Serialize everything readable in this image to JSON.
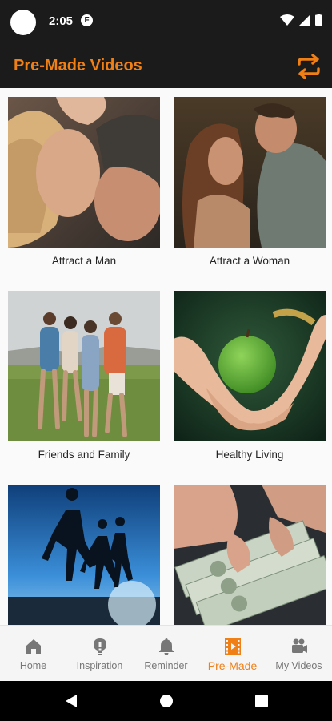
{
  "status": {
    "time": "2:05",
    "notification_badge": "F"
  },
  "app_bar": {
    "title": "Pre-Made Videos",
    "accent": "#f07f16"
  },
  "cards": [
    {
      "label": "Attract a Man"
    },
    {
      "label": "Attract a Woman"
    },
    {
      "label": "Friends and Family"
    },
    {
      "label": "Healthy Living"
    },
    {
      "label": ""
    },
    {
      "label": ""
    }
  ],
  "bottom_nav": {
    "active": "Pre-Made",
    "items": [
      {
        "label": "Home",
        "icon": "home-icon"
      },
      {
        "label": "Inspiration",
        "icon": "lightbulb-icon"
      },
      {
        "label": "Reminder",
        "icon": "bell-icon"
      },
      {
        "label": "Pre-Made",
        "icon": "film-icon"
      },
      {
        "label": "My Videos",
        "icon": "video-camera-icon"
      }
    ]
  }
}
